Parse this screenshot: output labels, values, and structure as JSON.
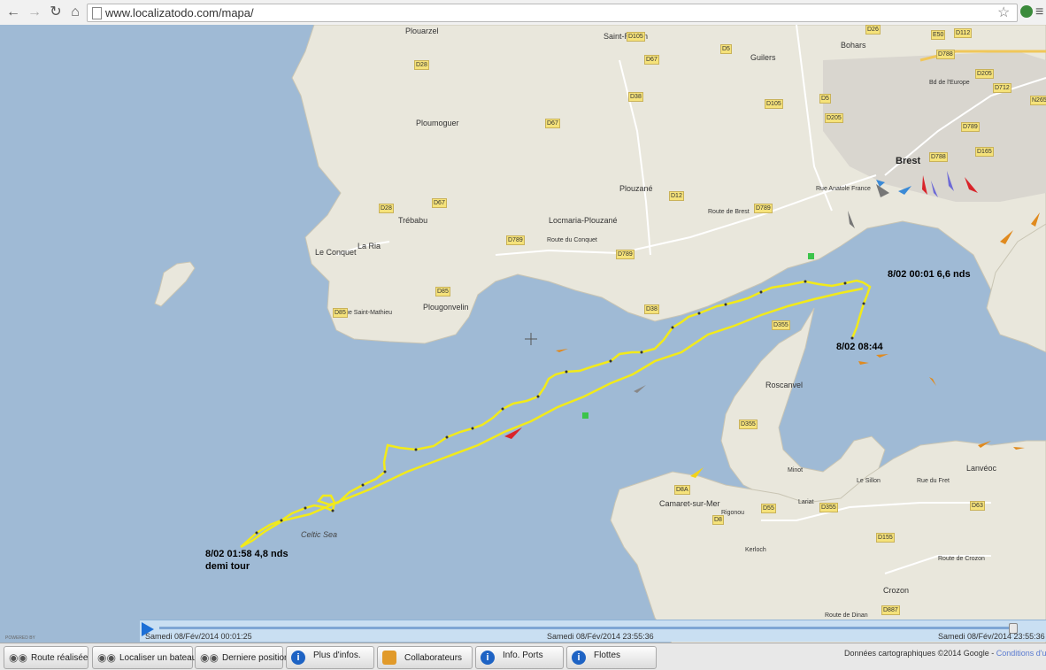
{
  "browser": {
    "url": "www.localizatodo.com/mapa/",
    "back_icon": "back-arrow-icon",
    "forward_icon": "forward-arrow-icon",
    "reload_icon": "reload-icon",
    "home_icon": "home-icon"
  },
  "map": {
    "places": {
      "plouarzel": "Plouarzel",
      "saint_renan": "Saint-Renan",
      "bohars": "Bohars",
      "guilers": "Guilers",
      "ploumoguer": "Ploumoguer",
      "brest": "Brest",
      "plouzane": "Plouzané",
      "locmaria": "Locmaria-Plouzané",
      "trebabu": "Trébabu",
      "le_conquet": "Le Conquet",
      "la_ria": "La Ria",
      "plougonvelin": "Plougonvelin",
      "roscanvel": "Roscanvel",
      "lanveoc": "Lanvéoc",
      "camaret": "Camaret-sur-Mer",
      "crozon": "Crozon",
      "celtic_sea": "Celtic Sea",
      "route_saint_mathieu": "Rue Saint-Mathieu",
      "route_conquet": "Route du Conquet",
      "route_brest": "Route de Brest",
      "rue_anatole": "Rue Anatole France",
      "bd_europe": "Bd de l'Europe",
      "route_crozon": "Route de Crozon",
      "route_fret": "Rue du Fret",
      "le_sillon": "Le Sillon",
      "lariat": "Lariat",
      "rigonou": "Rigonou",
      "kerloch": "Kerloch",
      "minot": "Minot",
      "route_dinan": "Route de Dinan"
    },
    "roads": [
      "D105",
      "D5",
      "D26",
      "D67",
      "D38",
      "D28",
      "D67",
      "D105",
      "D205",
      "D5",
      "D788",
      "D112",
      "D205",
      "D712",
      "N265",
      "E50",
      "D788",
      "D165",
      "D12",
      "D789",
      "D789",
      "D789",
      "D28",
      "D67",
      "D85",
      "D85",
      "D38",
      "D355",
      "D355",
      "D8A",
      "D8",
      "D55",
      "D355",
      "D63",
      "D155",
      "D887",
      "D789"
    ],
    "annotations": {
      "start": "8/02  00:01  6,6 nds",
      "end": "8/02  08:44",
      "turn_line1": "8/02 01:58 4,8 nds",
      "turn_line2": "demi tour"
    },
    "colors": {
      "sea": "#9fbad5",
      "land": "#e9e7dc",
      "track": "#f2ea1a",
      "urban": "#d9d6cf"
    }
  },
  "timeline": {
    "start_label": "Samedi 08/Fév/2014  00:01:25",
    "mid_label": "Samedi 08/Fév/2014  23:55:36",
    "end_label": "Samedi 08/Fév/2014  23:55:36"
  },
  "toolbar": {
    "buttons": [
      {
        "label": "Route réalisée",
        "icon": "binoculars-icon"
      },
      {
        "label": "Localiser un bateau",
        "icon": "binoculars-icon"
      },
      {
        "label": "Derniere position",
        "icon": "binoculars-icon"
      },
      {
        "label": "Plus d'infos.",
        "icon": "info-icon"
      },
      {
        "label": "Collaborateurs",
        "icon": "people-icon"
      },
      {
        "label": "Info. Ports",
        "icon": "info-icon"
      },
      {
        "label": "Flottes",
        "icon": "info-icon"
      }
    ]
  },
  "powered": "POWERED BY",
  "attribution": {
    "text": "Données cartographiques ©2014 Google - ",
    "link": "Conditions d'utilisation"
  }
}
